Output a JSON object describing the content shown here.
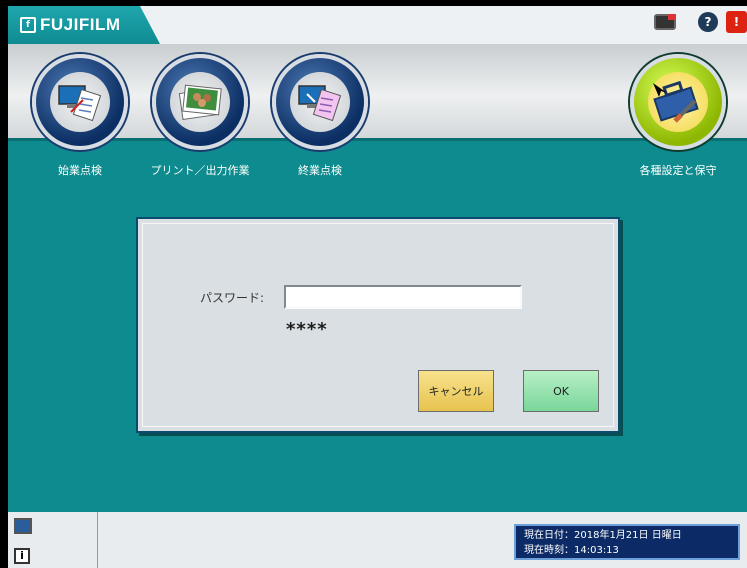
{
  "app": {
    "brand": "FUJIFILM",
    "brand_logo": "f"
  },
  "titlebar_icons": [
    {
      "name": "monitor-alert-icon"
    },
    {
      "name": "help-icon",
      "glyph": "?"
    },
    {
      "name": "alert-icon",
      "glyph": "!"
    }
  ],
  "launchers": [
    {
      "label": "始業点検"
    },
    {
      "label": "プリント／出力作業"
    },
    {
      "label": "終業点検"
    },
    {
      "label": "各種設定と保守"
    }
  ],
  "dialog": {
    "password_label": "パスワード:",
    "password_value": "",
    "mask": "****",
    "cancel_label": "キャンセル",
    "ok_label": "OK"
  },
  "status": {
    "date_line": "現在日付：2018年1月21日 日曜日",
    "time_line": "現在時刻：14:03:13",
    "info_glyph": "i"
  },
  "colors": {
    "workspace": "#0d8b8e",
    "brand": "#1fa6ad",
    "dialog": "#d9dfe3",
    "cancel": "#e7c34f",
    "ok": "#79d699",
    "datetime": "#0c2b66"
  }
}
